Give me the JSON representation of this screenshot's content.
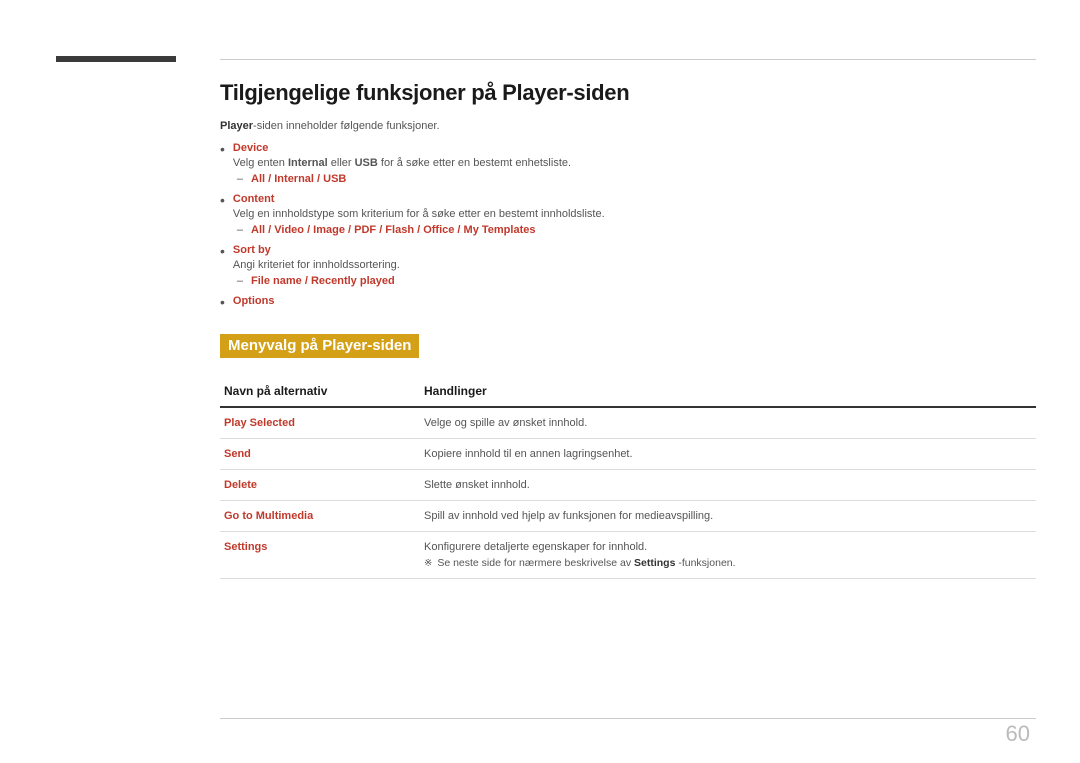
{
  "page": {
    "number": "60",
    "title": "Tilgjengelige funksjoner på Player-siden",
    "intro": {
      "text_before": "Player",
      "text_after": "-siden inneholder følgende funksjoner."
    },
    "bullets": [
      {
        "label": "Device",
        "desc": "Velg enten Internal eller USB for å søke etter en bestemt enhetsliste.",
        "sub": "All / Internal / USB"
      },
      {
        "label": "Content",
        "desc": "Velg en innholdstype som kriterium for å søke etter en bestemt innholdsliste.",
        "sub": "All / Video / Image / PDF / Flash / Office / My Templates"
      },
      {
        "label": "Sort by",
        "desc": "Angi kriteriet for innholdssortering.",
        "sub": "File name / Recently played"
      },
      {
        "label": "Options",
        "desc": "",
        "sub": ""
      }
    ],
    "section_title": "Menyvalg på Player-siden",
    "table": {
      "col1_header": "Navn på alternativ",
      "col2_header": "Handlinger",
      "rows": [
        {
          "name": "Play Selected",
          "action": "Velge og spille av ønsket innhold."
        },
        {
          "name": "Send",
          "action": "Kopiere innhold til en annen lagringsenhet."
        },
        {
          "name": "Delete",
          "action": "Slette ønsket innhold."
        },
        {
          "name": "Go to Multimedia",
          "action": "Spill av innhold ved hjelp av funksjonen for medieavspilling."
        },
        {
          "name": "Settings",
          "action": "Konfigurere detaljerte egenskaper for innhold.",
          "note": "Se neste side for nærmere beskrivelse av",
          "note_bold": "Settings",
          "note_end": "-funksjonen."
        }
      ]
    }
  }
}
